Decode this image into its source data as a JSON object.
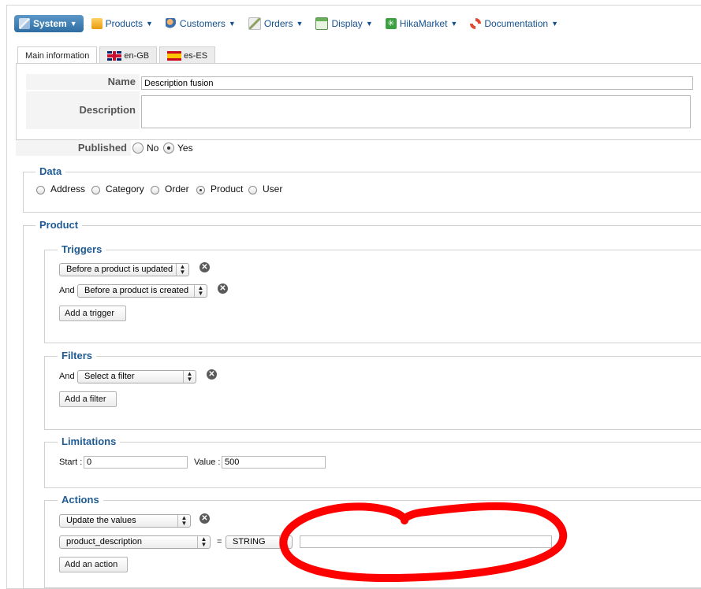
{
  "menu": [
    {
      "label": "System",
      "icon": "wand-icon",
      "color": "#5a8ab5"
    },
    {
      "label": "Products",
      "icon": "box-icon",
      "color": "#f0a020"
    },
    {
      "label": "Customers",
      "icon": "users-icon",
      "color": "#d07a30"
    },
    {
      "label": "Orders",
      "icon": "pen-doc-icon",
      "color": "#8aa060"
    },
    {
      "label": "Display",
      "icon": "window-icon",
      "color": "#5aa050"
    },
    {
      "label": "HikaMarket",
      "icon": "hikamarket-icon",
      "color": "#3aa040"
    },
    {
      "label": "Documentation",
      "icon": "lifebuoy-icon",
      "color": "#e05030"
    }
  ],
  "tabs": [
    "Main information",
    "en-GB",
    "es-ES"
  ],
  "main": {
    "name_label": "Name",
    "name_value": "Description fusion",
    "description_label": "Description",
    "description_value": "",
    "published_label": "Published",
    "published_no": "No",
    "published_yes": "Yes",
    "published_selected": "Yes"
  },
  "data_section": {
    "legend": "Data",
    "options": [
      "Address",
      "Category",
      "Order",
      "Product",
      "User"
    ],
    "selected": "Product"
  },
  "product_section": {
    "legend": "Product",
    "triggers": {
      "legend": "Triggers",
      "trigger1": "Before a product is updated",
      "and_label": "And",
      "trigger2": "Before a product is created",
      "add_button": "Add a trigger"
    },
    "filters": {
      "legend": "Filters",
      "and_label": "And",
      "filter1": "Select a filter",
      "add_button": "Add a filter"
    },
    "limitations": {
      "legend": "Limitations",
      "start_label": "Start :",
      "start_value": "0",
      "value_label": "Value :",
      "value_value": "500"
    },
    "actions": {
      "legend": "Actions",
      "action1": "Update the values",
      "column": "product_description",
      "equals": "=",
      "type": "STRING",
      "value": "",
      "add_button": "Add an action"
    }
  },
  "annotation_color": "#ff0000"
}
